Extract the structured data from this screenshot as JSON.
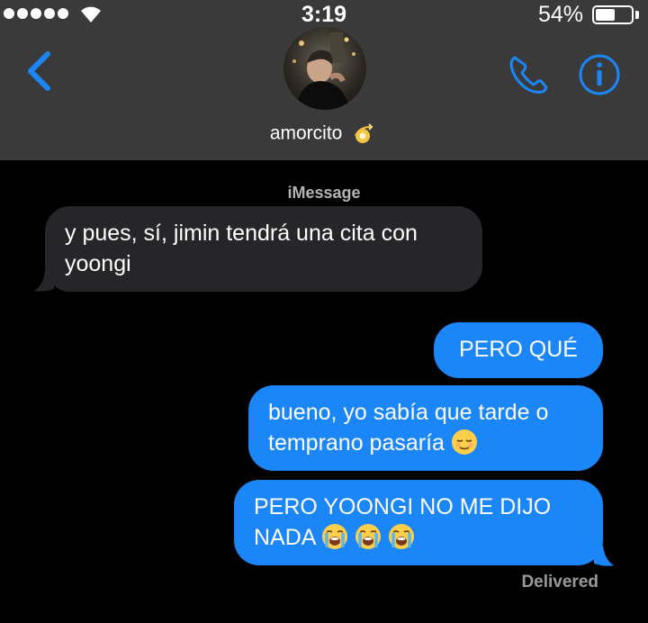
{
  "status_bar": {
    "time": "3:19",
    "battery_percent": "54%",
    "battery_level": 0.54,
    "signal_dots": 5
  },
  "header": {
    "contact_name": "amorcito",
    "contact_emoji": "dizzy-emoji",
    "back_icon": "chevron-left-icon",
    "call_icon": "phone-icon",
    "info_icon": "info-icon",
    "accent_color": "#1a86f8"
  },
  "conversation": {
    "service_label": "iMessage",
    "messages": [
      {
        "direction": "incoming",
        "text_line1": "y pues, sí, jimin tendrá una cita con",
        "text_line2": "yoongi"
      },
      {
        "direction": "outgoing",
        "text": "PERO QUÉ"
      },
      {
        "direction": "outgoing",
        "text_line1": "bueno, yo sabía que tarde o",
        "text_line2": "temprano pasaría",
        "emoji": "relieved-face-emoji"
      },
      {
        "direction": "outgoing",
        "text_line1": "PERO YOONGI NO ME DIJO",
        "text_line2": "NADA",
        "emoji": "loudly-crying-face-emoji",
        "emoji_count": 3
      }
    ],
    "delivered_label": "Delivered"
  },
  "colors": {
    "header_bg": "#3a3a3a",
    "incoming_bubble": "#262629",
    "outgoing_bubble": "#1a86f8",
    "background": "#000000"
  }
}
